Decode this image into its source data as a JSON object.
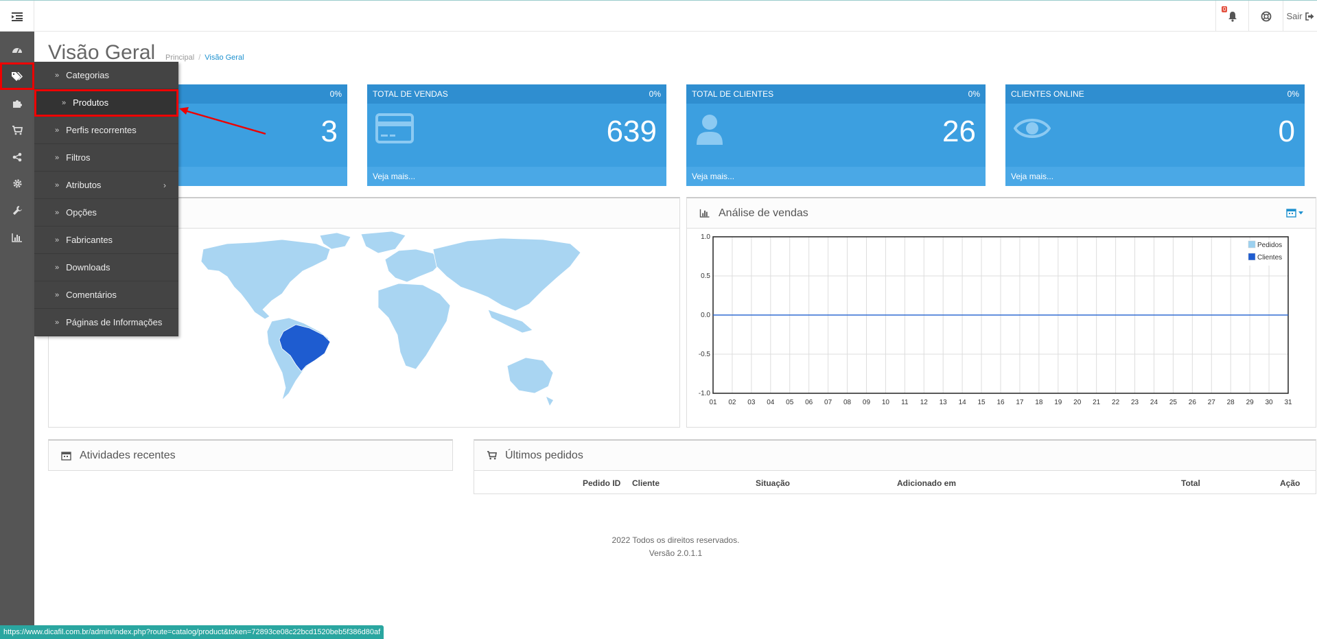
{
  "header": {
    "notif_count": "0",
    "logout_label": "Sair"
  },
  "sidebar": {
    "icons": [
      "dashboard-icon",
      "tags-icon",
      "puzzle-icon",
      "cart-icon",
      "share-icon",
      "gear-icon",
      "wrench-icon",
      "bar-chart-icon"
    ]
  },
  "flyout": {
    "items": [
      "Categorias",
      "Produtos",
      "Perfis recorrentes",
      "Filtros",
      "Atributos",
      "Opções",
      "Fabricantes",
      "Downloads",
      "Comentários",
      "Páginas de Informações"
    ]
  },
  "page": {
    "title": "Visão Geral",
    "breadcrumb": [
      "Principal",
      "Visão Geral"
    ]
  },
  "tiles": [
    {
      "title": "",
      "pct": "0%",
      "value": "3",
      "link": ""
    },
    {
      "title": "TOTAL DE VENDAS",
      "pct": "0%",
      "value": "639",
      "link": "Veja mais..."
    },
    {
      "title": "TOTAL DE CLIENTES",
      "pct": "0%",
      "value": "26",
      "link": "Veja mais..."
    },
    {
      "title": "CLIENTES ONLINE",
      "pct": "0%",
      "value": "0",
      "link": "Veja mais..."
    }
  ],
  "sales_panel": {
    "title": "Análise de vendas"
  },
  "chart_data": {
    "type": "line",
    "x": [
      "01",
      "02",
      "03",
      "04",
      "05",
      "06",
      "07",
      "08",
      "09",
      "10",
      "11",
      "12",
      "13",
      "14",
      "15",
      "16",
      "17",
      "18",
      "19",
      "20",
      "21",
      "22",
      "23",
      "24",
      "25",
      "26",
      "27",
      "28",
      "29",
      "30",
      "31"
    ],
    "series": [
      {
        "name": "Pedidos",
        "values": [
          0,
          0,
          0,
          0,
          0,
          0,
          0,
          0,
          0,
          0,
          0,
          0,
          0,
          0,
          0,
          0,
          0,
          0,
          0,
          0,
          0,
          0,
          0,
          0,
          0,
          0,
          0,
          0,
          0,
          0,
          0
        ],
        "color": "#9cd1f0"
      },
      {
        "name": "Clientes",
        "values": [
          0,
          0,
          0,
          0,
          0,
          0,
          0,
          0,
          0,
          0,
          0,
          0,
          0,
          0,
          0,
          0,
          0,
          0,
          0,
          0,
          0,
          0,
          0,
          0,
          0,
          0,
          0,
          0,
          0,
          0,
          0
        ],
        "color": "#1e5cd0"
      }
    ],
    "yticks": [
      "1.0",
      "0.5",
      "0.0",
      "-0.5",
      "-1.0"
    ],
    "ylim": [
      -1,
      1
    ],
    "grid": true,
    "legend": "top-right"
  },
  "activity_panel": {
    "title": "Atividades recentes"
  },
  "orders_panel": {
    "title": "Últimos pedidos",
    "columns": [
      "Pedido ID",
      "Cliente",
      "Situação",
      "Adicionado em",
      "Total",
      "Ação"
    ]
  },
  "footer": {
    "line1": "2022 Todos os direitos reservados.",
    "line2": "Versão 2.0.1.1"
  },
  "status_url": "https://www.dicafil.com.br/admin/index.php?route=catalog/product&token=72893ce08c22bcd1520beb5f386d80af",
  "colors": {
    "tile": "#3c9fe0",
    "accent": "#1e91cf",
    "map_land": "#a9d5f2",
    "map_highlight": "#1e5cd0"
  }
}
